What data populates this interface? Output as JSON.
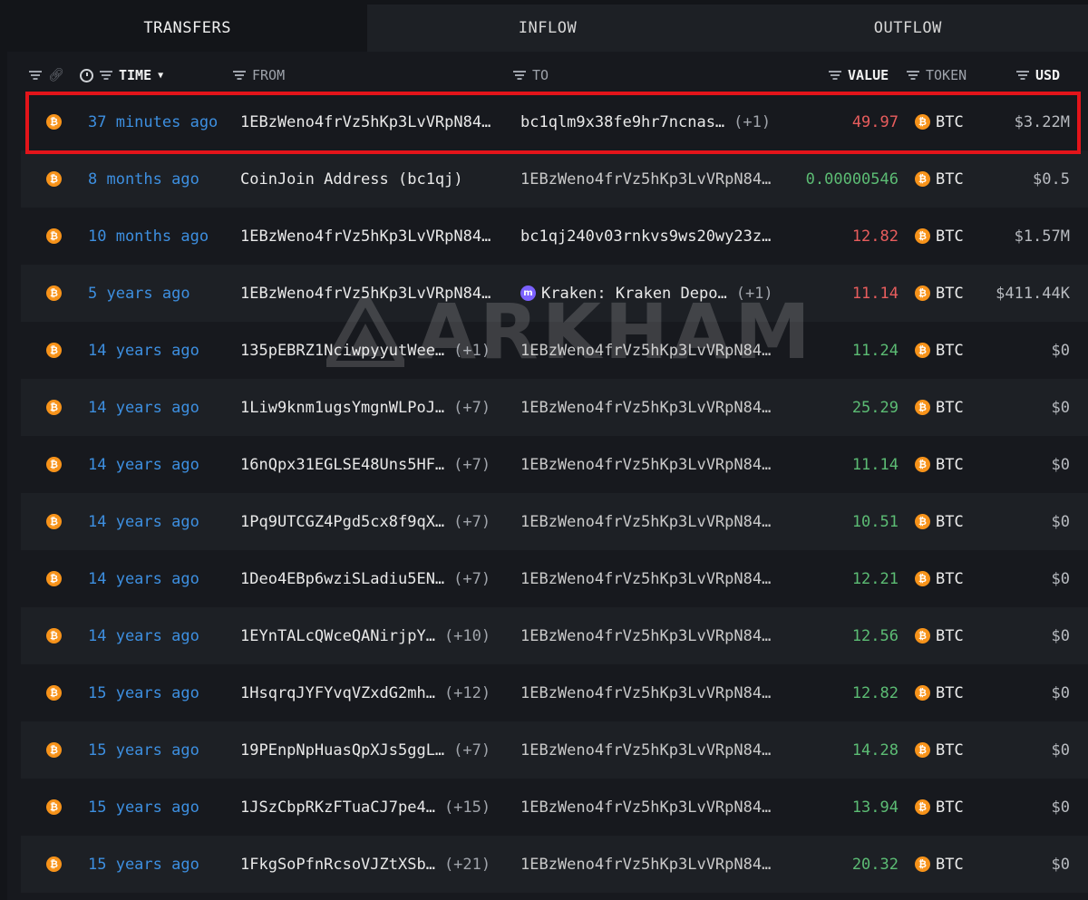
{
  "tabs": [
    {
      "label": "TRANSFERS",
      "active": true
    },
    {
      "label": "INFLOW",
      "active": false
    },
    {
      "label": "OUTFLOW",
      "active": false
    }
  ],
  "columns": {
    "time": "TIME",
    "from": "FROM",
    "to": "TO",
    "value": "VALUE",
    "token": "TOKEN",
    "usd": "USD"
  },
  "watermark": "ARKHAM",
  "colors": {
    "time_link": "#3d8fe0",
    "outflow_value": "#e85d5d",
    "inflow_value": "#5cbc74",
    "highlight_border": "#e3141a",
    "btc_icon": "#f7931a"
  },
  "rows": [
    {
      "time": "37 minutes ago",
      "from": "1EBzWeno4frVz5hKp3LvVRpN84…",
      "from_extra": "",
      "to": "bc1qlm9x38fe9hr7ncnas…",
      "to_extra": "(+1)",
      "to_entity": false,
      "value": "49.97",
      "direction": "out",
      "token": "BTC",
      "usd": "$3.22M",
      "highlighted": true
    },
    {
      "time": "8 months ago",
      "from": "CoinJoin Address (bc1qj)",
      "from_extra": "",
      "to": "1EBzWeno4frVz5hKp3LvVRpN84…",
      "to_extra": "",
      "to_entity": false,
      "value": "0.00000546",
      "direction": "in",
      "token": "BTC",
      "usd": "$0.5",
      "highlighted": false
    },
    {
      "time": "10 months ago",
      "from": "1EBzWeno4frVz5hKp3LvVRpN84…",
      "from_extra": "",
      "to": "bc1qj240v03rnkvs9ws20wy23z…",
      "to_extra": "",
      "to_entity": false,
      "value": "12.82",
      "direction": "out",
      "token": "BTC",
      "usd": "$1.57M",
      "highlighted": false
    },
    {
      "time": "5 years ago",
      "from": "1EBzWeno4frVz5hKp3LvVRpN84…",
      "from_extra": "",
      "to": "Kraken: Kraken Depo…",
      "to_extra": "(+1)",
      "to_entity": true,
      "value": "11.14",
      "direction": "out",
      "token": "BTC",
      "usd": "$411.44K",
      "highlighted": false
    },
    {
      "time": "14 years ago",
      "from": "135pEBRZ1NciwpyyutWee…",
      "from_extra": "(+1)",
      "to": "1EBzWeno4frVz5hKp3LvVRpN84…",
      "to_extra": "",
      "to_entity": false,
      "value": "11.24",
      "direction": "in",
      "token": "BTC",
      "usd": "$0",
      "highlighted": false
    },
    {
      "time": "14 years ago",
      "from": "1Liw9knm1ugsYmgnWLPoJ…",
      "from_extra": "(+7)",
      "to": "1EBzWeno4frVz5hKp3LvVRpN84…",
      "to_extra": "",
      "to_entity": false,
      "value": "25.29",
      "direction": "in",
      "token": "BTC",
      "usd": "$0",
      "highlighted": false
    },
    {
      "time": "14 years ago",
      "from": "16nQpx31EGLSE48Uns5HF…",
      "from_extra": "(+7)",
      "to": "1EBzWeno4frVz5hKp3LvVRpN84…",
      "to_extra": "",
      "to_entity": false,
      "value": "11.14",
      "direction": "in",
      "token": "BTC",
      "usd": "$0",
      "highlighted": false
    },
    {
      "time": "14 years ago",
      "from": "1Pq9UTCGZ4Pgd5cx8f9qX…",
      "from_extra": "(+7)",
      "to": "1EBzWeno4frVz5hKp3LvVRpN84…",
      "to_extra": "",
      "to_entity": false,
      "value": "10.51",
      "direction": "in",
      "token": "BTC",
      "usd": "$0",
      "highlighted": false
    },
    {
      "time": "14 years ago",
      "from": "1Deo4EBp6wziSLadiu5EN…",
      "from_extra": "(+7)",
      "to": "1EBzWeno4frVz5hKp3LvVRpN84…",
      "to_extra": "",
      "to_entity": false,
      "value": "12.21",
      "direction": "in",
      "token": "BTC",
      "usd": "$0",
      "highlighted": false
    },
    {
      "time": "14 years ago",
      "from": "1EYnTALcQWceQANirjpY…",
      "from_extra": "(+10)",
      "to": "1EBzWeno4frVz5hKp3LvVRpN84…",
      "to_extra": "",
      "to_entity": false,
      "value": "12.56",
      "direction": "in",
      "token": "BTC",
      "usd": "$0",
      "highlighted": false
    },
    {
      "time": "15 years ago",
      "from": "1HsqrqJYFYvqVZxdG2mh…",
      "from_extra": "(+12)",
      "to": "1EBzWeno4frVz5hKp3LvVRpN84…",
      "to_extra": "",
      "to_entity": false,
      "value": "12.82",
      "direction": "in",
      "token": "BTC",
      "usd": "$0",
      "highlighted": false
    },
    {
      "time": "15 years ago",
      "from": "19PEnpNpHuasQpXJs5ggL…",
      "from_extra": "(+7)",
      "to": "1EBzWeno4frVz5hKp3LvVRpN84…",
      "to_extra": "",
      "to_entity": false,
      "value": "14.28",
      "direction": "in",
      "token": "BTC",
      "usd": "$0",
      "highlighted": false
    },
    {
      "time": "15 years ago",
      "from": "1JSzCbpRKzFTuaCJ7pe4…",
      "from_extra": "(+15)",
      "to": "1EBzWeno4frVz5hKp3LvVRpN84…",
      "to_extra": "",
      "to_entity": false,
      "value": "13.94",
      "direction": "in",
      "token": "BTC",
      "usd": "$0",
      "highlighted": false
    },
    {
      "time": "15 years ago",
      "from": "1FkgSoPfnRcsoVJZtXSb…",
      "from_extra": "(+21)",
      "to": "1EBzWeno4frVz5hKp3LvVRpN84…",
      "to_extra": "",
      "to_entity": false,
      "value": "20.32",
      "direction": "in",
      "token": "BTC",
      "usd": "$0",
      "highlighted": false
    }
  ]
}
